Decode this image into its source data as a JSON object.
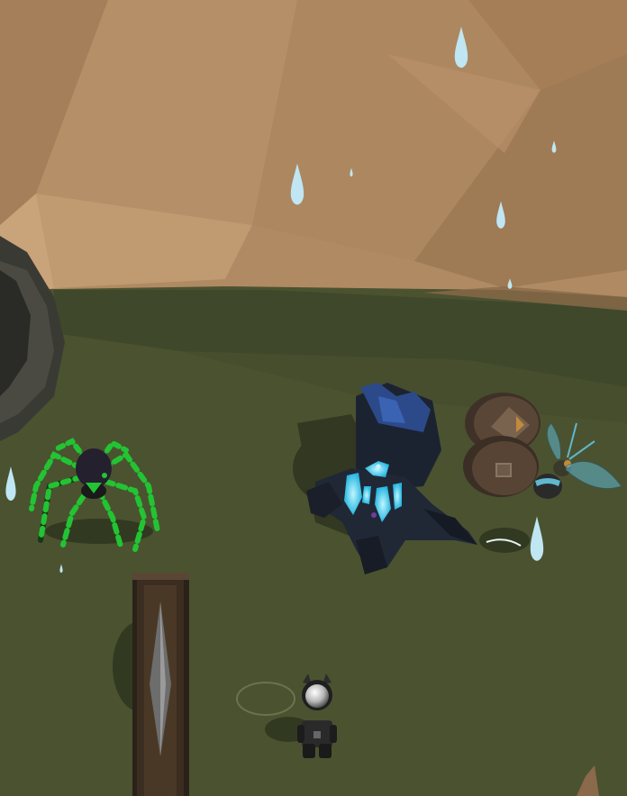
{
  "scene": {
    "type": "3d-game-viewport",
    "hud_text": [],
    "colors": {
      "sky_wall": "#b08a63",
      "sky_wall_light": "#c39d73",
      "ground": "#4b5230",
      "ground_far": "#3f4a2c",
      "rain": "#bfe6f2",
      "spider_accent": "#22c433",
      "golem_glow": "#3fd3f5",
      "golem_body": "#1c2330",
      "wasp_wing": "#5fb8d0",
      "barrel_wood": "#5a4636",
      "player_helmet": "#d8d8d8"
    },
    "entities": [
      {
        "kind": "boulder",
        "icon": "rock"
      },
      {
        "kind": "spider-enemy",
        "icon": "spider"
      },
      {
        "kind": "stone-golem-enemy",
        "icon": "golem"
      },
      {
        "kind": "barrel-stack",
        "icon": "barrel"
      },
      {
        "kind": "wasp-enemy",
        "icon": "wasp"
      },
      {
        "kind": "wooden-trapdoor",
        "icon": "door"
      },
      {
        "kind": "player-character",
        "icon": "robot-cat"
      }
    ]
  }
}
